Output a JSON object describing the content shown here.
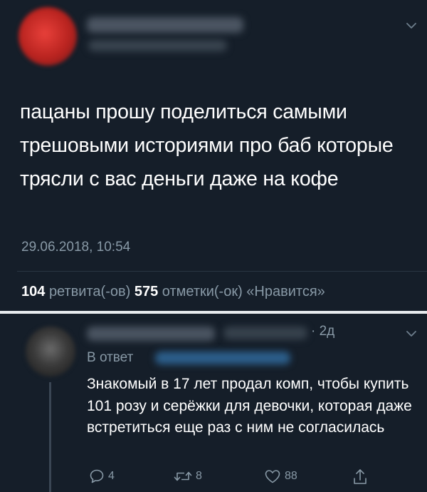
{
  "main_tweet": {
    "text": "пацаны прошу поделиться самыми трешовыми историями про баб которые трясли с вас деньги даже на кофе",
    "timestamp": "29.06.2018, 10:54",
    "retweets_count": "104",
    "retweets_label": "ретвита(-ов)",
    "likes_count": "575",
    "likes_label": "отметки(-ок) «Нравится»"
  },
  "reply": {
    "time": "· 2д",
    "in_reply_to_label": "В ответ",
    "text": "Знакомый в 17 лет продал комп, чтобы купить 101 розу и серёжки для девочки, которая даже встретиться еще раз с ним не согласилась",
    "reply_count": "4",
    "retweet_count": "8",
    "like_count": "88"
  },
  "icons": {
    "menu": "chevron-down-icon",
    "reply": "speech-bubble-icon",
    "retweet": "retweet-arrows-icon",
    "like": "heart-icon",
    "share": "share-upload-icon"
  },
  "colors": {
    "background": "#151e29",
    "text": "#ffffff",
    "secondary_text": "#8899a6",
    "separator": "#e7ebee"
  }
}
